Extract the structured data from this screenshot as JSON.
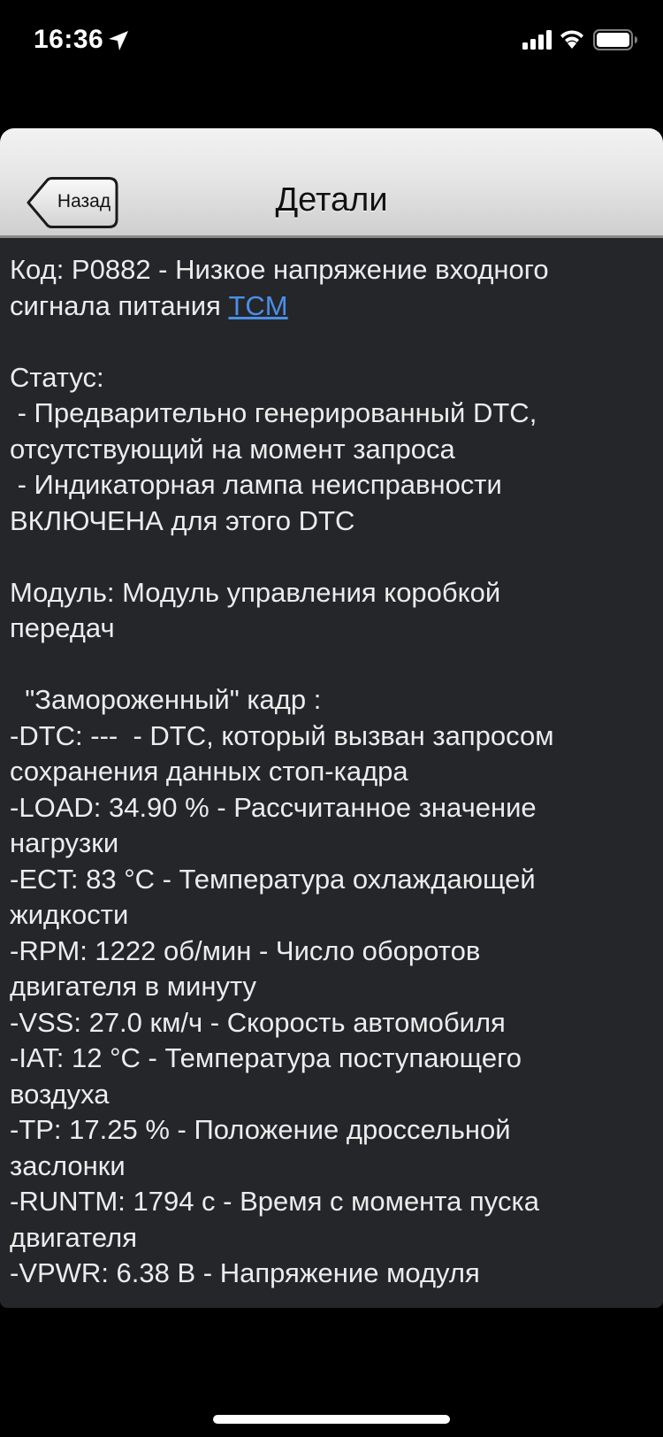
{
  "status_bar": {
    "time": "16:36",
    "icons": [
      "location-arrow-icon",
      "cellular-signal-icon",
      "wifi-icon",
      "battery-icon"
    ]
  },
  "nav": {
    "back_label": "Назад",
    "title": "Детали"
  },
  "details": {
    "code_line1_prefix": "Код: P0882 - Низкое напряжение входного",
    "code_line2_prefix": "сигнала питания ",
    "code_link": "TCM",
    "status_header": "Статус:",
    "status_lines": [
      " - Предварительно генерированный DTC,",
      "отсутствующий на момент запроса",
      " - Индикаторная лампа неисправности",
      "ВКЛЮЧЕНА для этого DTC"
    ],
    "module_lines": [
      "Модуль: Модуль управления коробкой",
      "передач"
    ],
    "freeze_frame_header": "  \"Замороженный\" кадр :",
    "freeze_frame_lines": [
      "-DTC: ---  - DTC, который вызван запросом",
      "сохранения данных стоп-кадра",
      "-LOAD: 34.90 % - Рассчитанное значение",
      "нагрузки",
      "-ECT: 83 °C - Температура охлаждающей",
      "жидкости",
      "-RPM: 1222 об/мин - Число оборотов",
      "двигателя в минуту",
      "-VSS: 27.0 км/ч - Скорость автомобиля",
      "-IAT: 12 °C - Температура поступающего",
      "воздуха",
      "-TP: 17.25 % - Положение дроссельной",
      "заслонки",
      "-RUNTM: 1794 с - Время с момента пуска",
      "двигателя",
      "-VPWR: 6.38 В - Напряжение модуля"
    ]
  },
  "colors": {
    "background": "#000000",
    "content_bg": "#25262a",
    "text": "#ececec",
    "link": "#4a8fe7"
  }
}
